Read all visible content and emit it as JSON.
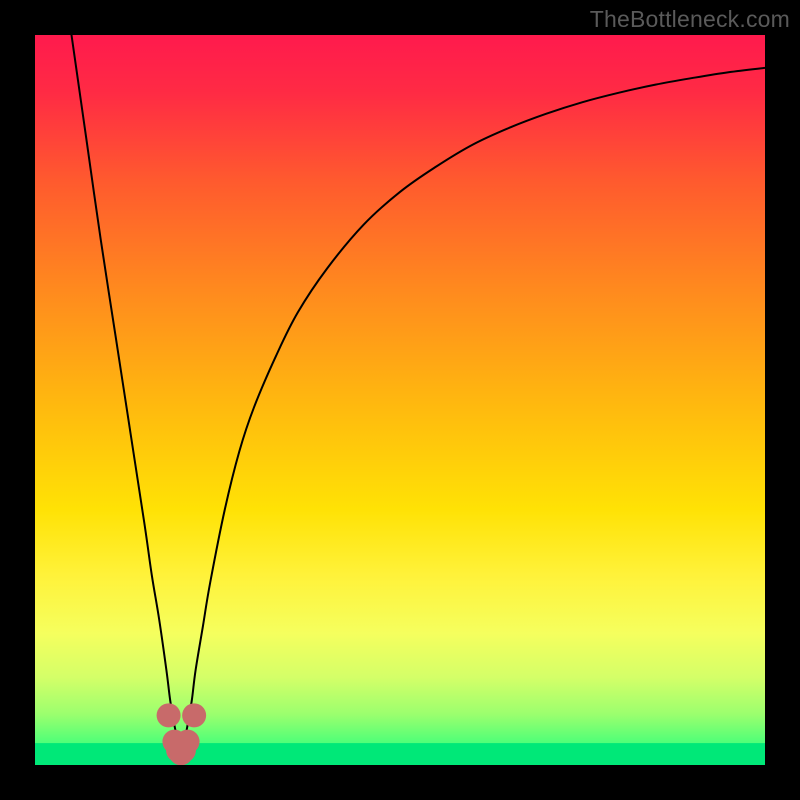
{
  "watermark": "TheBottleneck.com",
  "chart_data": {
    "type": "line",
    "title": "",
    "xlabel": "",
    "ylabel": "",
    "xlim": [
      0,
      100
    ],
    "ylim": [
      0,
      100
    ],
    "series": [
      {
        "name": "curve",
        "x": [
          5,
          7,
          9,
          11,
          13,
          15,
          16,
          17,
          18,
          18.5,
          19,
          19.5,
          20,
          20.5,
          21,
          21.5,
          22,
          23,
          24,
          26,
          28,
          30,
          33,
          36,
          40,
          45,
          50,
          55,
          60,
          65,
          70,
          75,
          80,
          85,
          90,
          95,
          100
        ],
        "y": [
          100,
          86,
          72,
          59,
          46,
          33,
          26,
          20,
          13,
          9,
          6,
          3.5,
          2,
          3.5,
          6,
          9,
          13,
          19,
          25,
          35,
          43,
          49,
          56,
          62,
          68,
          74,
          78.5,
          82,
          85,
          87.3,
          89.2,
          90.8,
          92.1,
          93.2,
          94.1,
          94.9,
          95.5
        ]
      }
    ],
    "markers": {
      "name": "bottom-highlight",
      "color": "#c86a6a",
      "x": [
        18.3,
        19.1,
        19.6,
        20.0,
        20.4,
        20.9,
        21.8
      ],
      "y": [
        6.8,
        3.2,
        2.0,
        1.6,
        2.0,
        3.2,
        6.8
      ]
    },
    "gradient_stops": [
      {
        "pos": 0.0,
        "color": "#ff1a4d"
      },
      {
        "pos": 0.08,
        "color": "#ff2b44"
      },
      {
        "pos": 0.2,
        "color": "#ff5a2e"
      },
      {
        "pos": 0.35,
        "color": "#ff8a1e"
      },
      {
        "pos": 0.5,
        "color": "#ffb70f"
      },
      {
        "pos": 0.65,
        "color": "#ffe205"
      },
      {
        "pos": 0.74,
        "color": "#fff23a"
      },
      {
        "pos": 0.82,
        "color": "#f5ff5e"
      },
      {
        "pos": 0.88,
        "color": "#d4ff68"
      },
      {
        "pos": 0.93,
        "color": "#9cff6e"
      },
      {
        "pos": 0.97,
        "color": "#4eff78"
      },
      {
        "pos": 1.0,
        "color": "#00e878"
      }
    ],
    "green_band": {
      "from_y": 0,
      "to_y": 3
    }
  }
}
